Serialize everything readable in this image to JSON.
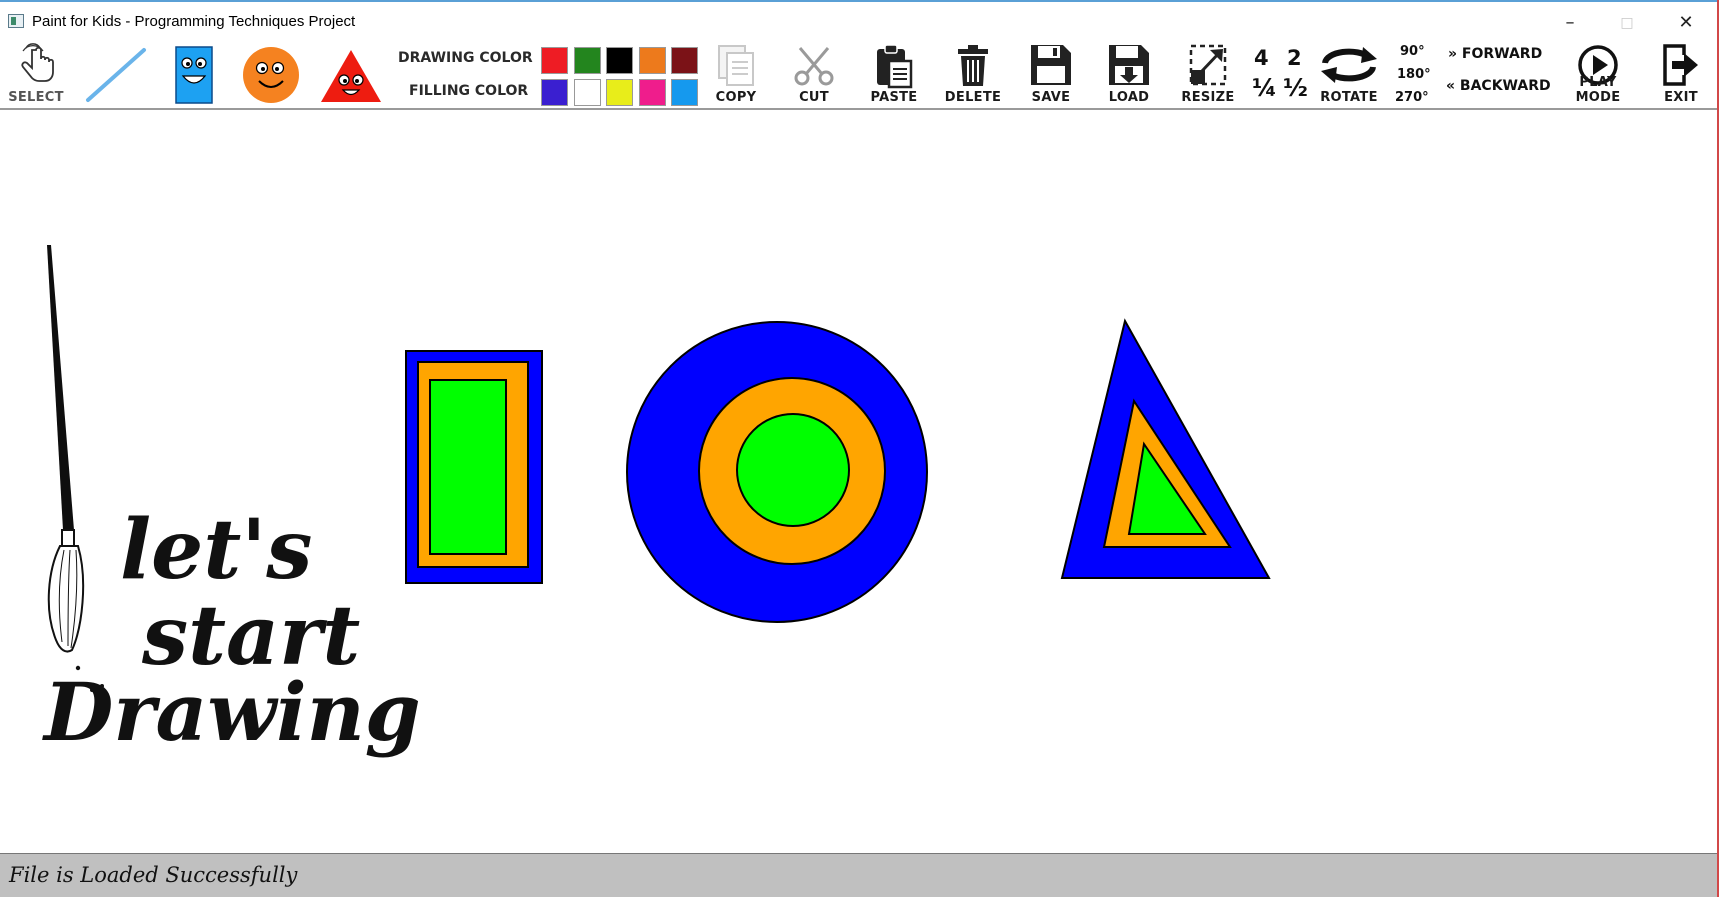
{
  "window": {
    "title": "Paint for Kids - Programming Techniques Project",
    "minimize": "–",
    "maximize": "□",
    "close": "✕"
  },
  "toolbar": {
    "select": "SELECT",
    "drawing_color": "DRAWING COLOR",
    "filling_color": "FILLING COLOR",
    "copy": "COPY",
    "cut": "CUT",
    "paste": "PASTE",
    "delete": "DELETE",
    "save": "SAVE",
    "load": "LOAD",
    "resize": "RESIZE",
    "resize_factors": [
      "4",
      "2",
      "¼",
      "½"
    ],
    "rotate": "ROTATE",
    "rotate_angles": [
      "90°",
      "180°",
      "270°"
    ],
    "forward": "» FORWARD",
    "backward": "« BACKWARD",
    "play_mode": "PLAY MODE",
    "exit": "EXIT"
  },
  "palette": {
    "row1": [
      "#ee1c24",
      "#23851e",
      "#000000",
      "#ed7a1c",
      "#7b1217"
    ],
    "row2": [
      "#3a1fd0",
      "#ffffff",
      "#e8ed1a",
      "#ef1d8c",
      "#1599ee"
    ]
  },
  "canvas": {
    "slogan": [
      "let's",
      "start",
      "Drawing"
    ],
    "shape_colors": {
      "outer": "#0000ff",
      "middle": "#ffa500",
      "inner": "#00ff00",
      "outline": "#000000"
    }
  },
  "status": {
    "message": "File is Loaded Successfully"
  }
}
